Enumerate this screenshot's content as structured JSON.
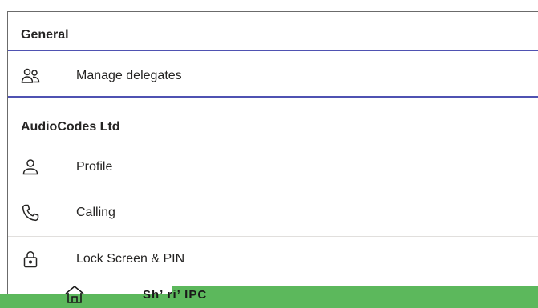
{
  "sections": {
    "general": {
      "title": "General"
    },
    "account": {
      "title": "AudioCodes Ltd"
    }
  },
  "items": {
    "manage_delegates": {
      "label": "Manage delegates",
      "icon": "people-icon"
    },
    "profile": {
      "label": "Profile",
      "icon": "person-icon"
    },
    "calling": {
      "label": "Calling",
      "icon": "phone-icon"
    },
    "lock_screen": {
      "label": "Lock Screen & PIN",
      "icon": "lock-icon"
    }
  },
  "bottom_bar": {
    "glitched_text": "Sh’ ri’ IPC",
    "icon": "home-icon"
  },
  "colors": {
    "accent": "#4f52b2",
    "text": "#252423",
    "bottom_bar": "#5cb85c"
  }
}
